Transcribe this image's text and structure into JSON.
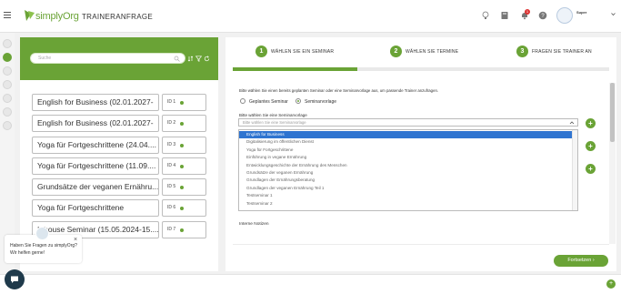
{
  "header": {
    "logo_text": "simplyOrg",
    "page_title": "TRAINERANFRAGE",
    "notification_count": "1",
    "user_name": "Super"
  },
  "left": {
    "search_placeholder": "Suche",
    "seminars": [
      {
        "title": "English for Business (02.01.2027-",
        "id": "ID 1"
      },
      {
        "title": "English for Business (02.01.2027-",
        "id": "ID 2"
      },
      {
        "title": "Yoga für Fortgeschrittene (24.04....",
        "id": "ID 3"
      },
      {
        "title": "Yoga für Fortgeschrittene (11.09....",
        "id": "ID 4"
      },
      {
        "title": "Grundsätze der veganen Ernähru...",
        "id": "ID 5"
      },
      {
        "title": "Yoga für Fortgeschrittene",
        "id": "ID 6"
      },
      {
        "title": "Inhouse Seminar (15.05.2024-15....",
        "id": "ID 7"
      }
    ]
  },
  "wizard": {
    "steps": [
      {
        "number": "1",
        "label": "WÄHLEN SIE EIN SEMINAR"
      },
      {
        "number": "2",
        "label": "WÄHLEN SIE TERMINE"
      },
      {
        "number": "3",
        "label": "FRAGEN SIE TRAINER AN"
      }
    ],
    "progress": 0.33,
    "instruction": "Bitte wählen Sie einen bereits geplanten Seminar oder eine Seminarvorlage aus, um passende Trainer anzufragen.",
    "radio_options": [
      {
        "label": "Geplantes Seminar",
        "checked": false
      },
      {
        "label": "Seminarvorlage",
        "checked": true
      }
    ],
    "select_label": "Bitte wählen Sie eine Seminarvorlage",
    "select_placeholder": "Bitte wählen Sie eine Seminarvorlage",
    "options": [
      "English for Business",
      "Digitalisierung im öffentlichen Dienst",
      "Yoga für Fortgeschrittene",
      "Einführung in vegane Ernährung",
      "Entwicklungsgeschichte der Ernährung des Menschen",
      "Grundsätze der veganen Ernährung",
      "Grundlagen der Ernährungsberatung",
      "Grundlagen der veganen Ernährung Teil 1",
      "Testseminar 1",
      "Testseminar 2"
    ],
    "highlighted_option": "English for Business",
    "notes_label": "Interne Notizen",
    "next_button": "Fortsetzen"
  },
  "chat": {
    "message": "Haben Sie Fragen zu simplyOrg? Wir helfen gerne!"
  },
  "colors": {
    "brand_green": "#6aa336",
    "highlight_blue": "#2f74d0",
    "badge_red": "#dd3333"
  }
}
